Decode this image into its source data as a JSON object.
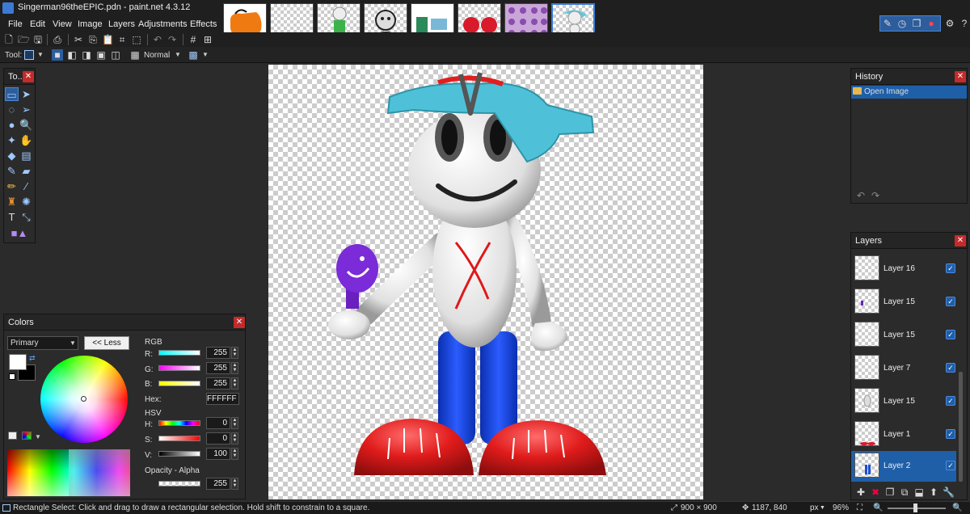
{
  "window": {
    "title": "Singerman96theEPIC.pdn - paint.net 4.3.12",
    "controls": [
      "—",
      "❐",
      "✕"
    ]
  },
  "menu": [
    "File",
    "Edit",
    "View",
    "Image",
    "Layers",
    "Adjustments",
    "Effects"
  ],
  "toolbar": {
    "tool_label": "Tool:",
    "blend_mode": "Normal"
  },
  "tools_panel": {
    "title": "To..."
  },
  "history": {
    "title": "History",
    "items": [
      "Open Image"
    ]
  },
  "layers": {
    "title": "Layers",
    "items": [
      {
        "name": "Layer 16",
        "visible": true
      },
      {
        "name": "Layer 15",
        "visible": true
      },
      {
        "name": "Layer 15",
        "visible": true
      },
      {
        "name": "Layer 7",
        "visible": true
      },
      {
        "name": "Layer 15",
        "visible": true
      },
      {
        "name": "Layer 1",
        "visible": true
      },
      {
        "name": "Layer 2",
        "visible": true,
        "selected": true
      }
    ]
  },
  "colors": {
    "title": "Colors",
    "mode": "Primary",
    "less_button": "<< Less",
    "rgb_label": "RGB",
    "r_label": "R:",
    "r": "255",
    "g_label": "G:",
    "g": "255",
    "b_label": "B:",
    "b": "255",
    "hex_label": "Hex:",
    "hex": "FFFFFF",
    "hsv_label": "HSV",
    "h_label": "H:",
    "h": "0",
    "s_label": "S:",
    "s": "0",
    "v_label": "V:",
    "v": "100",
    "opacity_label": "Opacity - Alpha",
    "alpha": "255",
    "primary_color": "#ffffff",
    "secondary_color": "#000000"
  },
  "status": {
    "hint": "Rectangle Select: Click and drag to draw a rectangular selection. Hold shift to constrain to a square.",
    "image_size": "900 × 900",
    "cursor": "1187, 840",
    "unit": "px",
    "zoom": "96%"
  }
}
